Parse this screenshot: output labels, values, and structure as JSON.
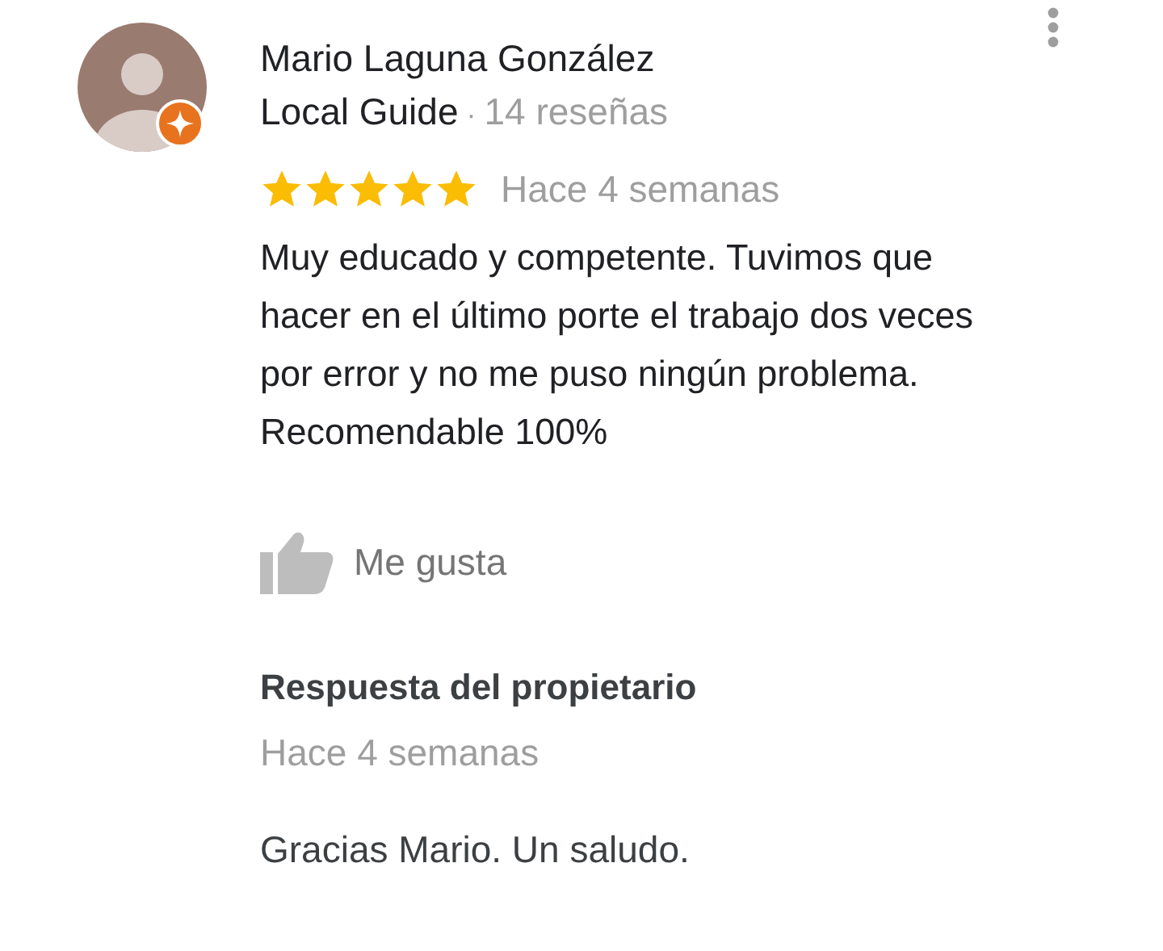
{
  "review": {
    "author": "Mario Laguna González",
    "badge": "Local Guide",
    "separator": "·",
    "review_count": "14 reseñas",
    "stars": 5,
    "date": "Hace 4 semanas",
    "text": "Muy educado y competente. Tuvimos que hacer en el último porte el trabajo dos veces por error y no me puso ningún problema. Recomendable 100%",
    "like_label": "Me gusta"
  },
  "owner_response": {
    "title": "Respuesta del propietario",
    "date": "Hace 4 semanas",
    "text": "Gracias Mario. Un saludo."
  }
}
